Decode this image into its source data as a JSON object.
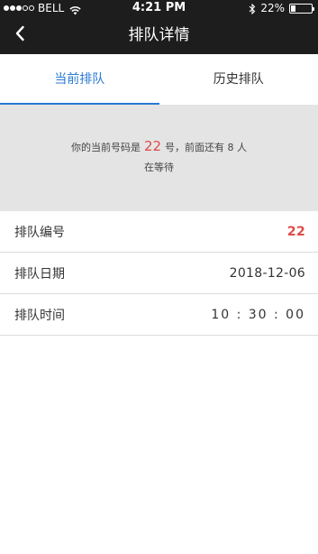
{
  "status_bar": {
    "carrier": "BELL",
    "time": "4:21 PM",
    "battery": "22%",
    "battery_level": 0.22,
    "signal_bars_filled": 3,
    "signal_bars_total": 5
  },
  "nav": {
    "title": "排队详情",
    "back_icon": "chevron-left-icon"
  },
  "tabs": [
    {
      "label": "当前排队",
      "active": true
    },
    {
      "label": "历史排队",
      "active": false
    }
  ],
  "info": {
    "prefix": "你的当前号码是",
    "number": "22",
    "suffix": "号，前面还有 8 人",
    "line2": "在等待"
  },
  "details": [
    {
      "label": "排队编号",
      "value": "22"
    },
    {
      "label": "排队日期",
      "value": "2018-12-06"
    },
    {
      "label": "排队时间",
      "value": "10 : 30 : 00"
    }
  ],
  "colors": {
    "accent_blue": "#2a7ad3",
    "highlight_red": "#e04848",
    "topbar": "#1d1d1d",
    "panel_gray": "#e4e4e4"
  }
}
